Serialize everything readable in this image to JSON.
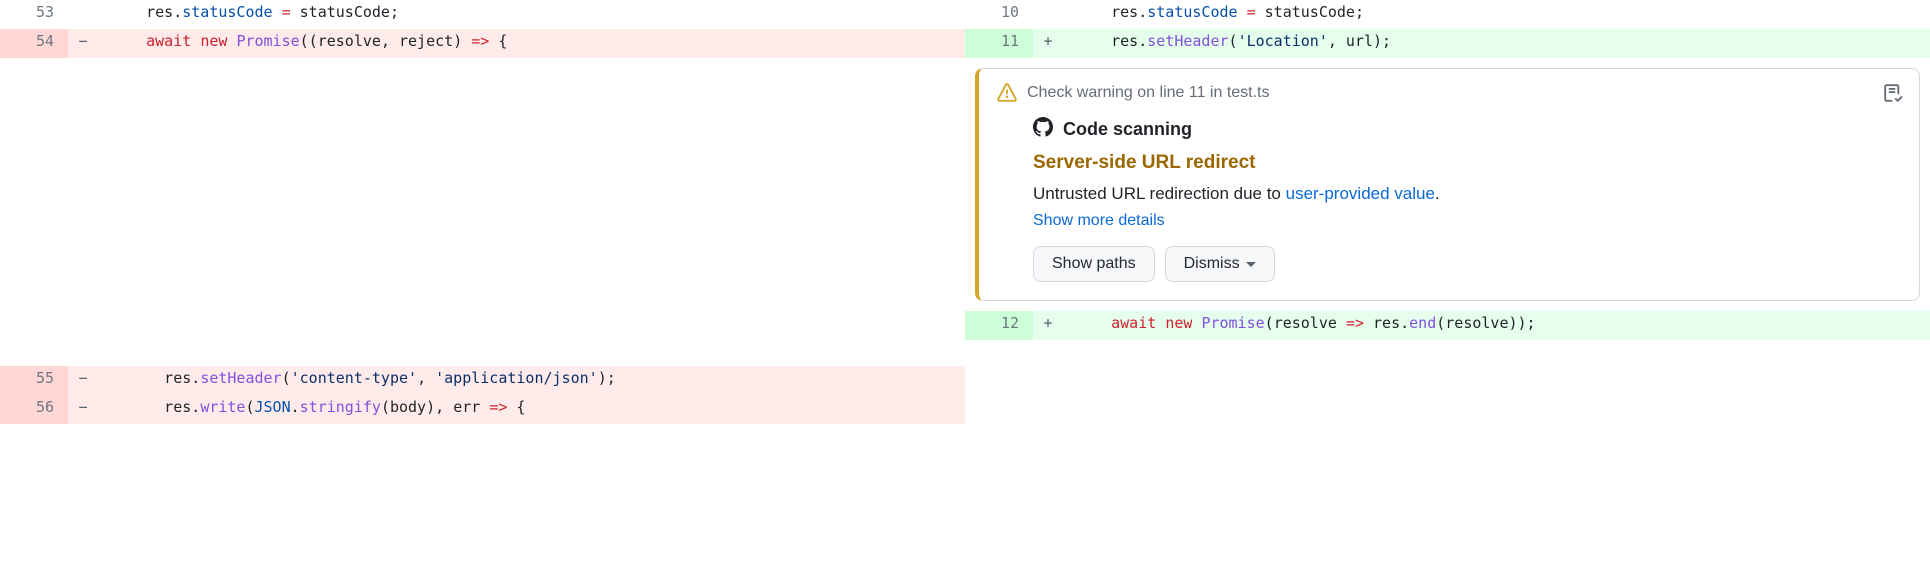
{
  "diff": {
    "left": {
      "rows": [
        {
          "n": "53",
          "marker": "",
          "cls": "ctx",
          "tokens": [
            {
              "t": "    res.",
              "c": "tok-plain"
            },
            {
              "t": "statusCode",
              "c": "tok-prop"
            },
            {
              "t": " ",
              "c": "tok-plain"
            },
            {
              "t": "=",
              "c": "tok-kw"
            },
            {
              "t": " statusCode;",
              "c": "tok-plain"
            }
          ]
        },
        {
          "n": "54",
          "marker": "−",
          "cls": "del",
          "tokens": [
            {
              "t": "    ",
              "c": "tok-plain"
            },
            {
              "t": "await",
              "c": "tok-kw"
            },
            {
              "t": " ",
              "c": "tok-plain"
            },
            {
              "t": "new",
              "c": "tok-kw"
            },
            {
              "t": " ",
              "c": "tok-plain"
            },
            {
              "t": "Promise",
              "c": "tok-fn"
            },
            {
              "t": "((",
              "c": "tok-plain"
            },
            {
              "t": "resolve",
              "c": "tok-plain"
            },
            {
              "t": ", ",
              "c": "tok-plain"
            },
            {
              "t": "reject",
              "c": "tok-plain"
            },
            {
              "t": ") ",
              "c": "tok-plain"
            },
            {
              "t": "=>",
              "c": "tok-kw"
            },
            {
              "t": " {",
              "c": "tok-plain"
            }
          ]
        },
        {
          "n": "55",
          "marker": "−",
          "cls": "del",
          "tokens": [
            {
              "t": "      res.",
              "c": "tok-plain"
            },
            {
              "t": "setHeader",
              "c": "tok-fn"
            },
            {
              "t": "(",
              "c": "tok-plain"
            },
            {
              "t": "'content-type'",
              "c": "tok-str"
            },
            {
              "t": ", ",
              "c": "tok-plain"
            },
            {
              "t": "'application/json'",
              "c": "tok-str"
            },
            {
              "t": ");",
              "c": "tok-plain"
            }
          ]
        },
        {
          "n": "56",
          "marker": "−",
          "cls": "del",
          "tokens": [
            {
              "t": "      res.",
              "c": "tok-plain"
            },
            {
              "t": "write",
              "c": "tok-fn"
            },
            {
              "t": "(",
              "c": "tok-plain"
            },
            {
              "t": "JSON",
              "c": "tok-prop"
            },
            {
              "t": ".",
              "c": "tok-plain"
            },
            {
              "t": "stringify",
              "c": "tok-fn"
            },
            {
              "t": "(body), ",
              "c": "tok-plain"
            },
            {
              "t": "err",
              "c": "tok-plain"
            },
            {
              "t": " ",
              "c": "tok-plain"
            },
            {
              "t": "=>",
              "c": "tok-kw"
            },
            {
              "t": " {",
              "c": "tok-plain"
            }
          ]
        }
      ]
    },
    "right": {
      "rows": [
        {
          "n": "10",
          "marker": "",
          "cls": "ctx",
          "tokens": [
            {
              "t": "    res.",
              "c": "tok-plain"
            },
            {
              "t": "statusCode",
              "c": "tok-prop"
            },
            {
              "t": " ",
              "c": "tok-plain"
            },
            {
              "t": "=",
              "c": "tok-kw"
            },
            {
              "t": " statusCode;",
              "c": "tok-plain"
            }
          ]
        },
        {
          "n": "11",
          "marker": "+",
          "cls": "add",
          "tokens": [
            {
              "t": "    res.",
              "c": "tok-plain"
            },
            {
              "t": "setHeader",
              "c": "tok-fn"
            },
            {
              "t": "(",
              "c": "tok-plain"
            },
            {
              "t": "'Location'",
              "c": "tok-str"
            },
            {
              "t": ", url);",
              "c": "tok-plain"
            }
          ]
        },
        {
          "n": "12",
          "marker": "+",
          "cls": "add",
          "tokens": [
            {
              "t": "    ",
              "c": "tok-plain"
            },
            {
              "t": "await",
              "c": "tok-kw"
            },
            {
              "t": " ",
              "c": "tok-plain"
            },
            {
              "t": "new",
              "c": "tok-kw"
            },
            {
              "t": " ",
              "c": "tok-plain"
            },
            {
              "t": "Promise",
              "c": "tok-fn"
            },
            {
              "t": "(",
              "c": "tok-plain"
            },
            {
              "t": "resolve",
              "c": "tok-plain"
            },
            {
              "t": " ",
              "c": "tok-plain"
            },
            {
              "t": "=>",
              "c": "tok-kw"
            },
            {
              "t": " res.",
              "c": "tok-plain"
            },
            {
              "t": "end",
              "c": "tok-fn"
            },
            {
              "t": "(resolve));",
              "c": "tok-plain"
            }
          ]
        }
      ]
    }
  },
  "annotation": {
    "header": "Check warning on line 11 in test.ts",
    "source": "Code scanning",
    "title": "Server-side URL redirect",
    "description_prefix": "Untrusted URL redirection due to ",
    "description_link": "user-provided value",
    "description_suffix": ".",
    "show_more": "Show more details",
    "buttons": {
      "show_paths": "Show paths",
      "dismiss": "Dismiss"
    }
  }
}
